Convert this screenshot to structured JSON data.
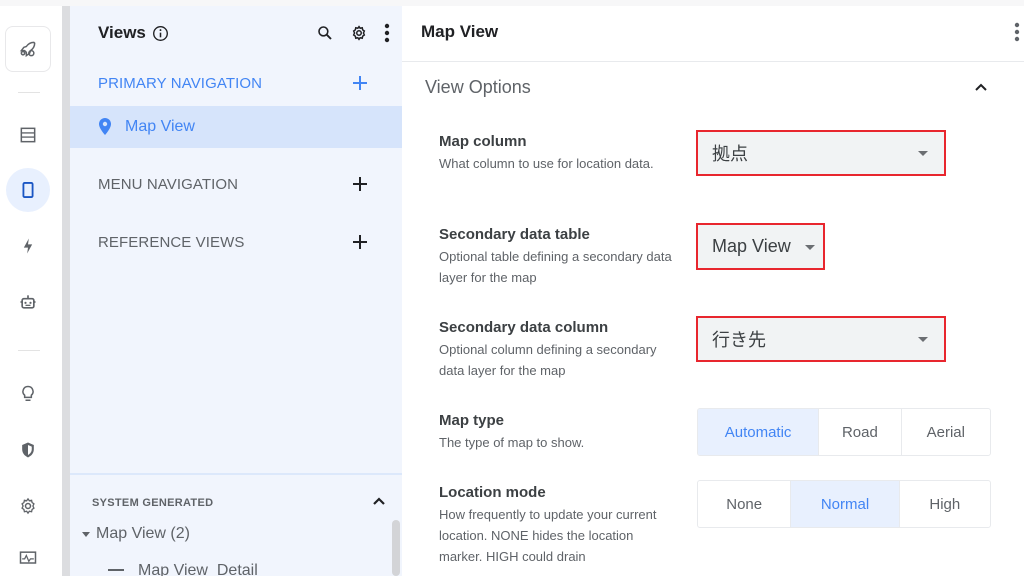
{
  "rail": {
    "items": [
      {
        "icon": "rocket-icon"
      },
      {
        "icon": "data-table-icon"
      },
      {
        "icon": "mobile-app-icon",
        "active": true
      },
      {
        "icon": "automation-bolt-icon"
      },
      {
        "icon": "bot-icon"
      },
      {
        "icon": "lightbulb-icon"
      },
      {
        "icon": "security-shield-icon"
      },
      {
        "icon": "settings-gear-icon"
      },
      {
        "icon": "monitor-icon"
      }
    ]
  },
  "views_panel": {
    "title": "Views",
    "sections": [
      {
        "label": "PRIMARY NAVIGATION",
        "active": true,
        "items": [
          {
            "label": "Map View",
            "icon": "location-pin-icon",
            "selected": true
          }
        ]
      },
      {
        "label": "MENU NAVIGATION",
        "items": []
      },
      {
        "label": "REFERENCE VIEWS",
        "items": []
      }
    ],
    "system_generated": {
      "label": "SYSTEM GENERATED",
      "groups": [
        {
          "label": "Map View (2)",
          "expanded": true,
          "items": [
            {
              "label": "Map View_Detail"
            }
          ]
        }
      ]
    }
  },
  "main": {
    "title": "Map View",
    "section_title": "View Options",
    "settings": [
      {
        "title": "Map column",
        "description": "What column to use for location data.",
        "value": "拠点"
      },
      {
        "title": "Secondary data table",
        "description": "Optional table defining a secondary data layer for the map",
        "value": "Map View"
      },
      {
        "title": "Secondary data column",
        "description": "Optional column defining a secondary data layer for the map",
        "value": "行き先"
      },
      {
        "title": "Map type",
        "description": "The type of map to show.",
        "options": [
          "Automatic",
          "Road",
          "Aerial"
        ],
        "selected": "Automatic"
      },
      {
        "title": "Location mode",
        "description": "How frequently to update your current location. NONE hides the location marker. HIGH could drain",
        "options": [
          "None",
          "Normal",
          "High"
        ],
        "selected": "Normal"
      }
    ]
  },
  "colors": {
    "accent": "#4285f4",
    "selected_bg": "#d6e4fb",
    "highlight_border": "#e8262e",
    "panel_bg": "#f1f5fd"
  }
}
